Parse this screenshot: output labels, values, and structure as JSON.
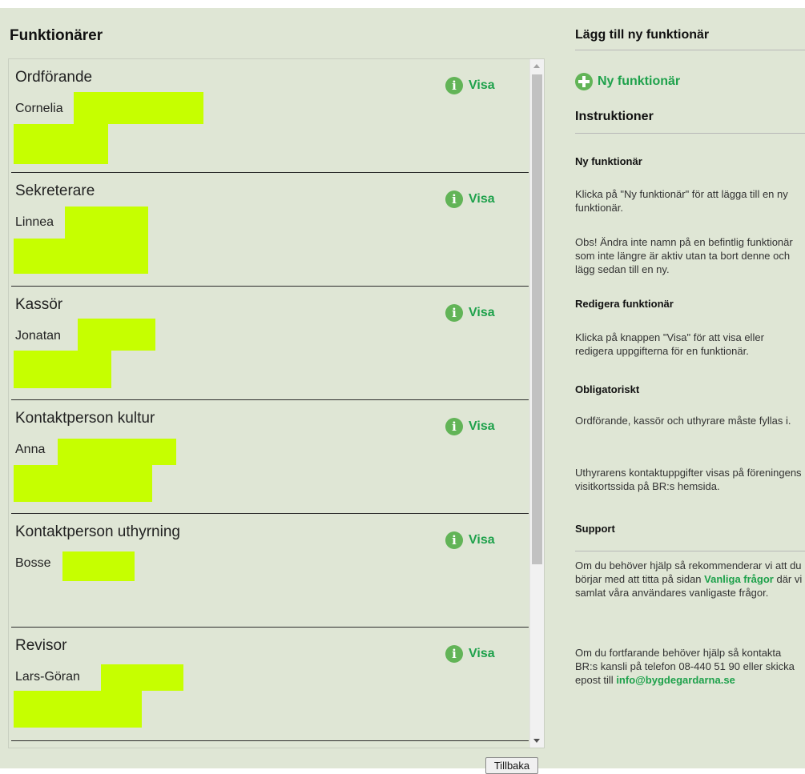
{
  "left": {
    "title": "Funktionärer",
    "entries": [
      {
        "role": "Ordförande",
        "name": "Cornelia",
        "action": "Visa"
      },
      {
        "role": "Sekreterare",
        "name": "Linnea",
        "action": "Visa"
      },
      {
        "role": "Kassör",
        "name": "Jonatan",
        "action": "Visa"
      },
      {
        "role": "Kontaktperson kultur",
        "name": "Anna",
        "action": "Visa"
      },
      {
        "role": "Kontaktperson uthyrning",
        "name": "Bosse",
        "action": "Visa"
      },
      {
        "role": "Revisor",
        "name": "Lars-Göran",
        "action": "Visa"
      }
    ],
    "back_button": "Tillbaka"
  },
  "right": {
    "add_heading": "Lägg till ny funktionär",
    "new_button": "Ny funktionär",
    "instructions_heading": "Instruktioner",
    "sections": {
      "new": {
        "heading": "Ny funktionär",
        "p1": "Klicka på \"Ny funktionär\" för att lägga till en ny funktionär.",
        "p2": "Obs! Ändra inte namn på en befintlig funktionär som inte längre är aktiv utan ta bort denne och lägg sedan till en ny."
      },
      "edit": {
        "heading": "Redigera funktionär",
        "p1": "Klicka på knappen \"Visa\" för att visa eller redigera uppgifterna för en funktionär."
      },
      "required": {
        "heading": "Obligatoriskt",
        "p1": "Ordförande, kassör och uthyrare måste fyllas i.",
        "p2": "Uthyrarens kontaktuppgifter visas på föreningens visitkortssida på BR:s hemsida."
      },
      "support": {
        "heading": "Support",
        "p1_before": "Om du behöver hjälp så rekommenderar vi att du börjar med att titta på sidan ",
        "p1_link": "Vanliga frågor",
        "p1_after": " där vi samlat våra användares vanligaste frågor.",
        "p2_before": "Om du fortfarande behöver hjälp så kontakta BR:s kansli på telefon 08-440 51 90 eller skicka epost till ",
        "p2_email": "info@bygdegardarna.se"
      }
    }
  },
  "colors": {
    "page_background": "#dfe6d5",
    "accent_green": "#1ea14b",
    "icon_green": "#62b457",
    "redaction_highlight": "#c6ff00"
  },
  "icons": {
    "info": "info-circle-icon",
    "add": "plus-circle-icon"
  }
}
